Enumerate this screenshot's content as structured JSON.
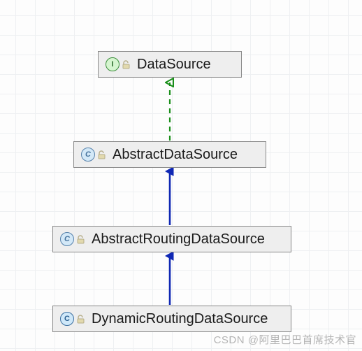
{
  "diagram": {
    "nodes": {
      "datasource": {
        "label": "DataSource",
        "kind_letter": "I",
        "kind": "interface"
      },
      "abstract_ds": {
        "label": "AbstractDataSource",
        "kind_letter": "C",
        "kind": "abstract-class"
      },
      "abstract_routing_ds": {
        "label": "AbstractRoutingDataSource",
        "kind_letter": "C",
        "kind": "abstract-class"
      },
      "dynamic_routing_ds": {
        "label": "DynamicRoutingDataSource",
        "kind_letter": "C",
        "kind": "class"
      }
    },
    "edges": [
      {
        "from": "abstract_ds",
        "to": "datasource",
        "style": "dashed-green",
        "relation": "implements"
      },
      {
        "from": "abstract_routing_ds",
        "to": "abstract_ds",
        "style": "solid-blue",
        "relation": "extends"
      },
      {
        "from": "dynamic_routing_ds",
        "to": "abstract_routing_ds",
        "style": "solid-blue",
        "relation": "extends"
      }
    ]
  },
  "watermark": "CSDN @阿里巴巴首席技术官"
}
